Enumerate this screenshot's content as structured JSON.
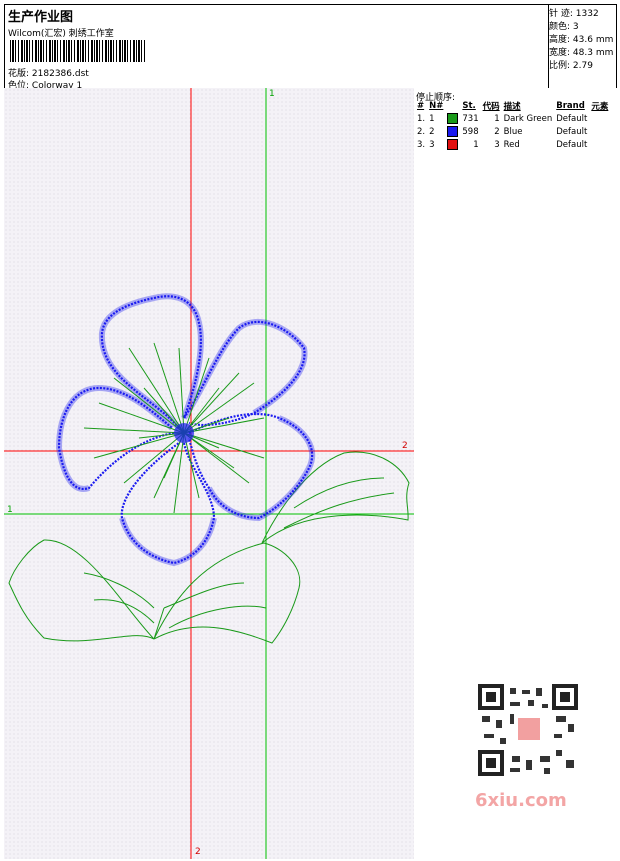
{
  "header": {
    "title": "生产作业图",
    "studio": "Wilcom(汇宏) 刺绣工作室",
    "design_label": "花版:",
    "design_value": "2182386.dst",
    "colorway_label": "色位:",
    "colorway_value": "Colorway 1"
  },
  "stats": {
    "stitches_label": "针 迹:",
    "stitches_value": "1332",
    "colors_label": "颜色:",
    "colors_value": "3",
    "height_label": "高度:",
    "height_value": "43.6 mm",
    "width_label": "宽度:",
    "width_value": "48.3 mm",
    "ratio_label": "比例:",
    "ratio_value": "2.79"
  },
  "stop_sequence": {
    "title": "停止顺序:",
    "headers": [
      "#",
      "N#",
      "St.",
      "代码",
      "描述",
      "Brand",
      "元素"
    ],
    "rows": [
      {
        "idx": "1.",
        "n": "1",
        "color": "#1a9a1a",
        "st": "731",
        "code": "1",
        "desc": "Dark Green",
        "brand": "Default"
      },
      {
        "idx": "2.",
        "n": "2",
        "color": "#1a1af0",
        "st": "598",
        "code": "2",
        "desc": "Blue",
        "brand": "Default"
      },
      {
        "idx": "3.",
        "n": "3",
        "color": "#e01010",
        "st": "1",
        "code": "3",
        "desc": "Red",
        "brand": "Default"
      }
    ]
  },
  "axes": {
    "green_v_top": "1",
    "green_h_left": "1",
    "red_h_right": "2",
    "red_v_bottom": "2"
  },
  "colors": {
    "guide_red": "#ff0000",
    "guide_green": "#00c000",
    "thread_blue": "#1a1af0",
    "thread_green": "#1a9a1a"
  },
  "watermark": "6xiu.com"
}
